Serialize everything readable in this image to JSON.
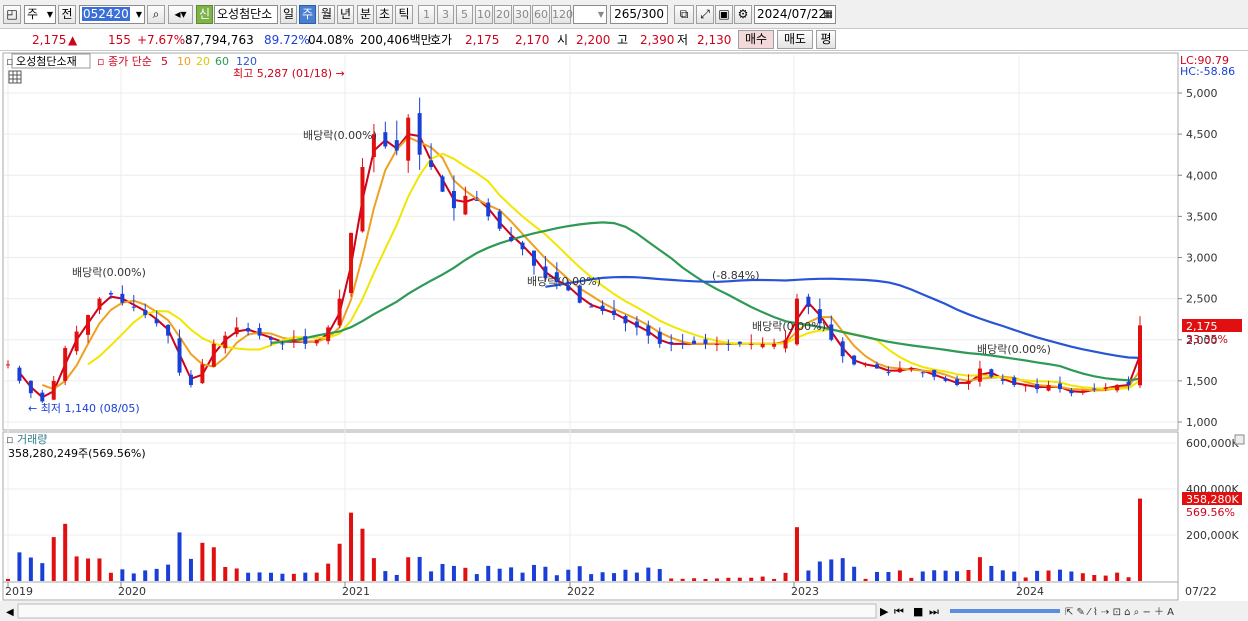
{
  "toolbar": {
    "period_main": "주",
    "prev_label": "전",
    "stock_code": "052420",
    "new_badge": "신",
    "stock_name": "오성첨단소",
    "periods": [
      "일",
      "주",
      "월",
      "년",
      "분",
      "초",
      "틱"
    ],
    "selected_period": "주",
    "intervals": [
      "1",
      "3",
      "5",
      "10",
      "20",
      "30",
      "60",
      "120"
    ],
    "count_display": "265/300",
    "date_value": "2024/07/22"
  },
  "quote": {
    "price": "2,175",
    "arrow": "▲",
    "change": "155",
    "change_pct": "+7.67%",
    "volume": "87,794,763",
    "vol_ratio": "89.72%",
    "turnover": "04.08%",
    "amount": "200,406백만",
    "ask_label": "호가",
    "ask": "2,175",
    "bid": "2,170",
    "open_label": "시",
    "open": "2,200",
    "high_label": "고",
    "high": "2,390",
    "low_label": "저",
    "low": "2,130",
    "buy_label": "매수",
    "sell_label": "매도",
    "eval_label": "평"
  },
  "chart_data": {
    "type": "candlestick",
    "title": "오성첨단소재",
    "ma_label": "종가 단순",
    "ma_periods": [
      "5",
      "10",
      "20",
      "60",
      "120"
    ],
    "ma_colors": [
      "#d0021b",
      "#f0a020",
      "#f2e600",
      "#2e9a55",
      "#2855d6"
    ],
    "lc": "LC:90.79",
    "hc": "HC:-58.86",
    "current_price_tag": "2,175",
    "current_pct_tag": "33.35%",
    "high_marker": "최고 5,287 (01/18)",
    "low_marker": "최저 1,140 (08/05)",
    "annotations": [
      "배당락(0.00%)",
      "배당락(0.00%)",
      "배당락(0.00%)",
      "(-8.84%)",
      "배당락(0.00%)",
      "배당락(0.00%)"
    ],
    "y_ticks": [
      "5,000",
      "4,500",
      "4,000",
      "3,500",
      "3,000",
      "2,500",
      "2,000",
      "1,500",
      "1,000"
    ],
    "y_values": [
      5000,
      4500,
      4000,
      3500,
      3000,
      2500,
      2000,
      1500,
      1000
    ],
    "x_ticks": [
      "2019",
      "2020",
      "2021",
      "2022",
      "2023",
      "2024",
      "07/22"
    ],
    "volume_title": "거래량",
    "volume_value": "358,280,249주(569.56%)",
    "volume_ticks": [
      "600,000K",
      "400,000K",
      "200,000K"
    ],
    "volume_tag": "358,280K",
    "volume_pct_tag": "569.56%",
    "price_path": [
      1700,
      1500,
      1350,
      1250,
      1500,
      1900,
      2100,
      2300,
      2500,
      2550,
      2450,
      2400,
      2300,
      2200,
      2050,
      1600,
      1450,
      1700,
      1950,
      2050,
      2150,
      2100,
      2050,
      2000,
      1950,
      2000,
      1950,
      2000,
      2150,
      2500,
      3300,
      4100,
      4500,
      4350,
      4300,
      4700,
      4250,
      4100,
      3800,
      3600,
      3750,
      3700,
      3500,
      3350,
      3200,
      3100,
      2900,
      2750,
      2700,
      2600,
      2450,
      2400,
      2350,
      2300,
      2200,
      2150,
      2050,
      1950,
      1950,
      1950,
      1950,
      1950,
      1950,
      1950,
      1950,
      1950,
      1950,
      1950,
      2000,
      2500,
      2400,
      2200,
      2000,
      1800,
      1700,
      1700,
      1650,
      1600,
      1650,
      1650,
      1600,
      1550,
      1500,
      1450,
      1500,
      1650,
      1550,
      1500,
      1450,
      1450,
      1400,
      1450,
      1400,
      1350,
      1380,
      1400,
      1420,
      1450,
      1450,
      2175
    ]
  },
  "bottom_bar": {
    "scroll_icons": [
      "play",
      "first",
      "stop",
      "next"
    ]
  }
}
